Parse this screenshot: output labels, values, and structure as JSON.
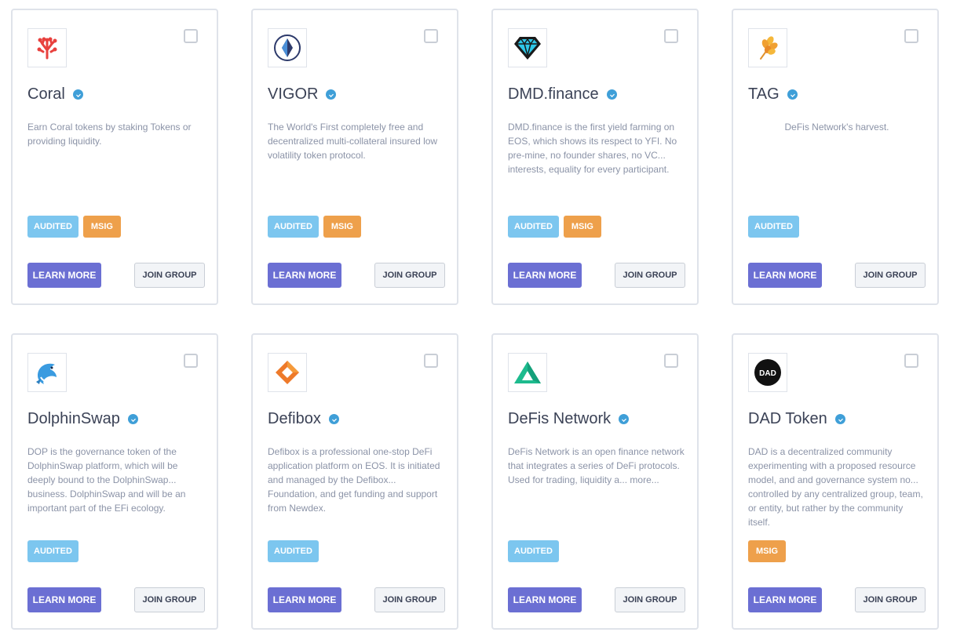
{
  "cards": [
    {
      "title": "Coral",
      "description": "Earn Coral tokens by staking Tokens or providing liquidity.",
      "badges": [
        "AUDITED",
        "MSIG"
      ],
      "learn_more": "LEARN MORE",
      "join_group": "JOIN GROUP",
      "icon": "coral-icon"
    },
    {
      "title": "VIGOR",
      "description": "The World's First completely free and decentralized multi-collateral insured low volatility token protocol.",
      "badges": [
        "AUDITED",
        "MSIG"
      ],
      "learn_more": "LEARN MORE",
      "join_group": "JOIN GROUP",
      "icon": "vigor-icon"
    },
    {
      "title": "DMD.finance",
      "description": "DMD.finance is the first yield farming on EOS, which shows its respect to YFI. No pre-mine, no founder shares, no VC... interests, equality for every participant.",
      "badges": [
        "AUDITED",
        "MSIG"
      ],
      "learn_more": "LEARN MORE",
      "join_group": "JOIN GROUP",
      "icon": "diamond-icon"
    },
    {
      "title": "TAG",
      "description": "DeFis Network's harvest.",
      "badges": [
        "AUDITED"
      ],
      "learn_more": "LEARN MORE",
      "join_group": "JOIN GROUP",
      "icon": "wheat-icon"
    },
    {
      "title": "DolphinSwap",
      "description": "DOP is the governance token of the DolphinSwap platform, which will be deeply bound to the DolphinSwap... business. DolphinSwap and will be an important part of the EFi ecology.",
      "badges": [
        "AUDITED"
      ],
      "learn_more": "LEARN MORE",
      "join_group": "JOIN GROUP",
      "icon": "dolphin-icon"
    },
    {
      "title": "Defibox",
      "description": "Defibox is a professional one-stop DeFi application platform on EOS. It is initiated and managed by the Defibox... Foundation, and get funding and support from Newdex.",
      "badges": [
        "AUDITED"
      ],
      "learn_more": "LEARN MORE",
      "join_group": "JOIN GROUP",
      "icon": "defibox-icon"
    },
    {
      "title": "DeFis Network",
      "description": "DeFis Network is an open finance network that integrates a series of DeFi protocols. Used for trading, liquidity a... more...",
      "badges": [
        "AUDITED"
      ],
      "learn_more": "LEARN MORE",
      "join_group": "JOIN GROUP",
      "icon": "defis-triangle-icon"
    },
    {
      "title": "DAD Token",
      "description": "DAD is a decentralized community experimenting with a proposed resource model, and and governance system no... controlled by any centralized group, team, or entity, but rather by the community itself.",
      "badges": [
        "MSIG"
      ],
      "learn_more": "LEARN MORE",
      "join_group": "JOIN GROUP",
      "icon": "dad-icon",
      "logo_text": "DAD"
    }
  ],
  "colors": {
    "audited": "#7cc6ef",
    "msig": "#eea04b",
    "learn_more": "#6b6fd3",
    "verified": "#3f9fd8"
  }
}
